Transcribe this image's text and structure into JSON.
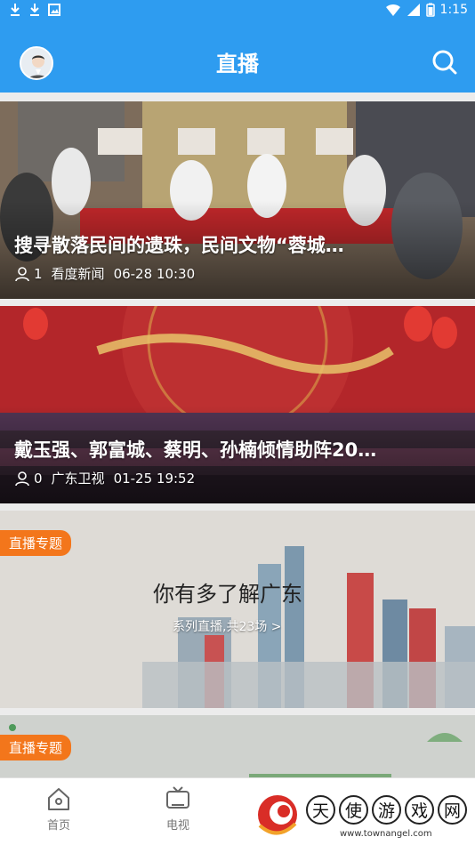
{
  "status_bar": {
    "time": "1:15",
    "icons": [
      "download-icon",
      "download-icon",
      "photo-icon",
      "wifi-icon",
      "signal-icon",
      "battery-icon"
    ]
  },
  "header": {
    "title": "直播",
    "avatar_icon": "avatar",
    "search_icon": "search-icon"
  },
  "feed": [
    {
      "title": "搜寻散落民间的遗珠，民间文物“蓉城…",
      "views": "1",
      "source": "看度新闻",
      "time": "06-28 10:30"
    },
    {
      "title": "戴玉强、郭富城、蔡明、孙楠倾情助阵20…",
      "views": "0",
      "source": "广东卫视",
      "time": "01-25 19:52"
    }
  ],
  "topic_cards": [
    {
      "tag": "直播专题",
      "title": "你有多了解广东",
      "subtitle": "系列直播,共23场 >"
    },
    {
      "tag": "直播专题"
    }
  ],
  "bottom_nav": [
    {
      "label": "首页",
      "icon": "home-icon"
    },
    {
      "label": "电视",
      "icon": "tv-icon"
    }
  ],
  "watermark": {
    "chars": [
      "天",
      "使",
      "游",
      "戏",
      "网"
    ],
    "url": "www.townangel.com"
  },
  "colors": {
    "primary": "#2e9cf0",
    "tag": "#f3761b"
  }
}
